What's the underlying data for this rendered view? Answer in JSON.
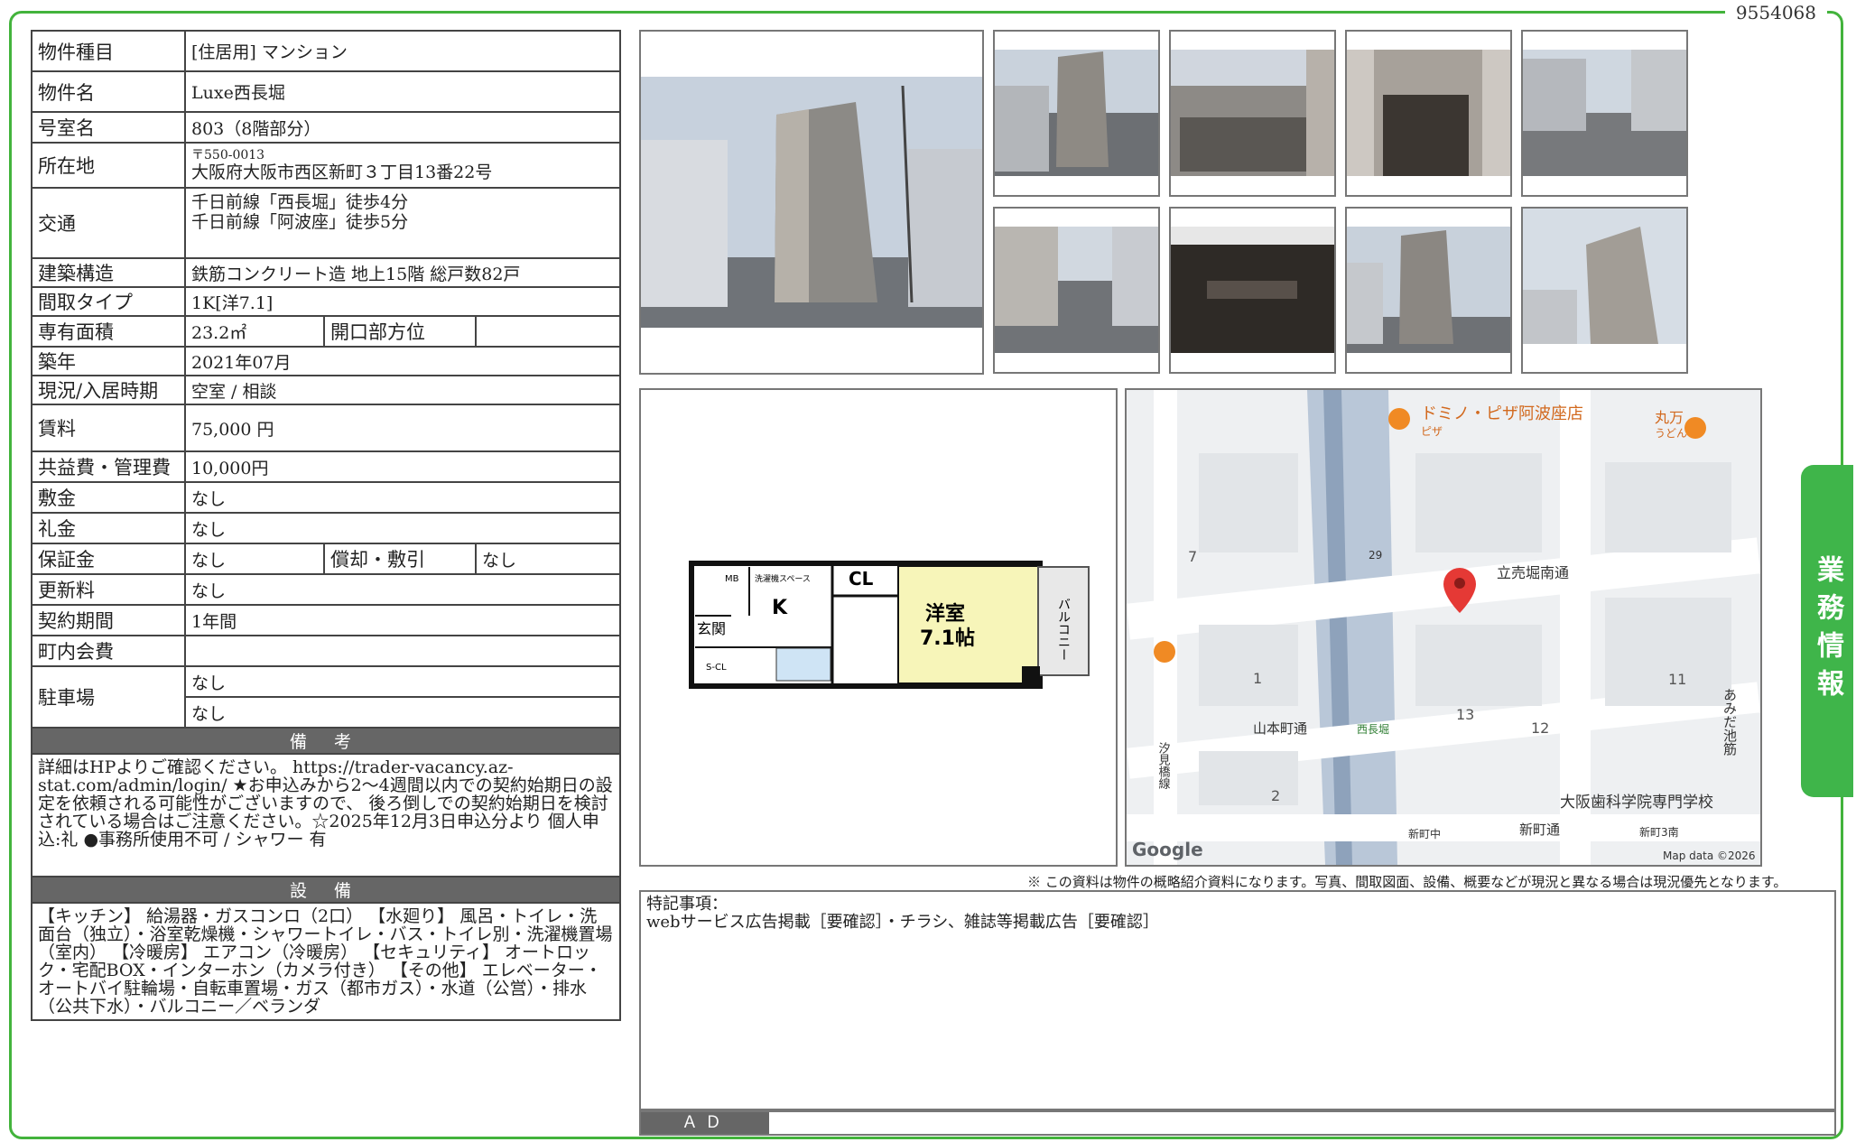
{
  "doc_id": "9554068",
  "side_tab": "業務情報",
  "rows": {
    "type_label": "物件種目",
    "type_value": "[住居用] マンション",
    "name_label": "物件名",
    "name_value": "Luxe西長堀",
    "room_label": "号室名",
    "room_value": "803（8階部分）",
    "address_label": "所在地",
    "postal": "〒550-0013",
    "address": "大阪府大阪市西区新町３丁目13番22号",
    "transit_label": "交通",
    "transit_1": "千日前線「西長堀」徒歩4分",
    "transit_2": "千日前線「阿波座」徒歩5分",
    "structure_label": "建築構造",
    "structure_value": "鉄筋コンクリート造 地上15階 総戸数82戸",
    "layout_label": "間取タイプ",
    "layout_value": "1K[洋7.1]",
    "area_label": "専有面積",
    "area_value": "23.2㎡",
    "opening_label": "開口部方位",
    "opening_value": "",
    "built_label": "築年",
    "built_value": "2021年07月",
    "status_label": "現況/入居時期",
    "status_value": "空室 / 相談",
    "rent_label": "賃料",
    "rent_value": "75,000 円",
    "fee_label": "共益費・管理費",
    "fee_value": "10,000円",
    "deposit_label": "敷金",
    "deposit_value": "なし",
    "keymoney_label": "礼金",
    "keymoney_value": "なし",
    "guarantee_label": "保証金",
    "guarantee_value": "なし",
    "amort_label": "償却・敷引",
    "amort_value": "なし",
    "renewal_label": "更新料",
    "renewal_value": "なし",
    "contract_label": "契約期間",
    "contract_value": "1年間",
    "community_label": "町内会費",
    "community_value": "",
    "parking_label": "駐車場",
    "parking_value_1": "なし",
    "parking_value_2": "なし"
  },
  "remarks_head": "備 考",
  "remarks": "詳細はHPよりご確認ください。 https://trader-vacancy.az-stat.com/admin/login/ ★お申込みから2〜4週間以内での契約始期日の設定を依頼される可能性がございますので、 後ろ倒しでの契約始期日を検討されている場合はご注意ください。☆2025年12月3日申込分より 個人申込:礼 ●事務所使用不可 / シャワー 有",
  "equipment_head": "設 備",
  "equipment": "【キッチン】 給湯器・ガスコンロ（2口） 【水廻り】 風呂・トイレ・洗面台（独立）・浴室乾燥機・シャワートイレ・バス・トイレ別・洗濯機置場（室内） 【冷暖房】 エアコン（冷暖房） 【セキュリティ】 オートロック・宅配BOX・インターホン（カメラ付き） 【その他】 エレベーター・オートバイ駐輪場・自転車置場・ガス（都市ガス）・水道（公営）・排水（公共下水）・バルコニー／ベランダ",
  "floorplan": {
    "room_name": "洋室",
    "room_size": "7.1帖",
    "cl": "CL",
    "k": "K",
    "entry": "玄関",
    "mb": "MB",
    "washer": "洗濯機スペース",
    "scl": "S-CL",
    "balcony": "バルコニー"
  },
  "map": {
    "places": [
      "ドミノ・ピザ阿波座店",
      "ピザ",
      "丸万",
      "うどん",
      "大阪歯科学院専門学校"
    ],
    "streets": [
      "立売堀南通",
      "山本町通",
      "新町通",
      "あみだ池筋",
      "汐見橋線"
    ],
    "stations": [
      "西長堀",
      "新町中",
      "新町3南"
    ],
    "blocks": [
      "7",
      "1",
      "2",
      "13",
      "12",
      "11",
      "29"
    ],
    "google": "Google",
    "credit": "Map data ©2026"
  },
  "disclaimer": "※ この資料は物件の概略紹介資料になります。写真、間取図面、設備、概要などが現況と異なる場合は現況優先となります。",
  "notes_title": "特記事項：",
  "notes_body": "webサービス広告掲載［要確認］・チラシ、雑誌等掲載広告［要確認］",
  "ad_label": "ＡＤ",
  "colors": {
    "green": "#43b33c",
    "header_gray": "#666666",
    "pin_red": "#e53935"
  }
}
